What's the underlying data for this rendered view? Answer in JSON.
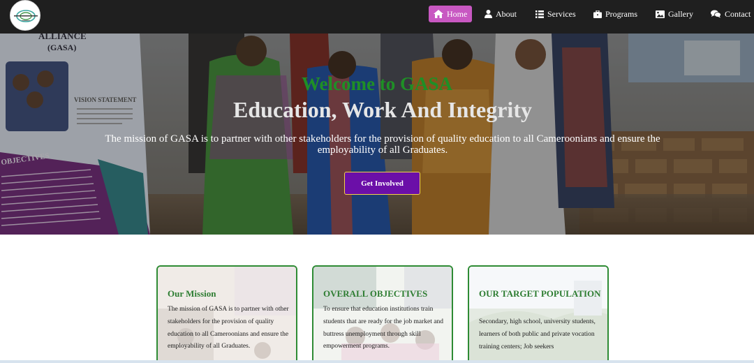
{
  "nav": {
    "logo_icon": "gasa-logo-icon",
    "items": [
      {
        "label": "Home",
        "icon": "home-icon",
        "active": true
      },
      {
        "label": "About",
        "icon": "user-icon"
      },
      {
        "label": "Services",
        "icon": "list-icon"
      },
      {
        "label": "Programs",
        "icon": "briefcase-icon"
      },
      {
        "label": "Gallery",
        "icon": "image-icon"
      },
      {
        "label": "Contact",
        "icon": "chat-icon"
      }
    ],
    "active_color": "#c858c2",
    "bar_color": "#1f1f1f"
  },
  "hero": {
    "welcome": "Welcome to GASA",
    "title": "Education, Work And Integrity",
    "mission": "The mission of GASA is to partner with other stakeholders for the provision of quality education to all Cameroonians and ensure the employability of all Graduates.",
    "cta_label": "Get Involved",
    "welcome_color": "#1f8f26",
    "cta_color": "#6b0fa8",
    "banner_text": {
      "alliance": "ALLIANCE",
      "gasa": "(GASA)",
      "vision": "VISION STATEMENT",
      "objectives": "OBJECTIVES"
    }
  },
  "cards": [
    {
      "title": "Our Mission",
      "text": "The mission of GASA is to partner with other stakeholders for the provision of quality education to all Cameroonians and ensure the employability of all Graduates."
    },
    {
      "title": "OVERALL OBJECTIVES",
      "text": "To ensure that education institutions train students that are ready for the job market and buttress unemployment through skill empowerment programs."
    },
    {
      "title": "OUR TARGET POPULATION",
      "text": "Secondary, high school, university students, learners of both public and private vocation training centers; Job seekers"
    }
  ],
  "card_border_color": "#2e8b34"
}
